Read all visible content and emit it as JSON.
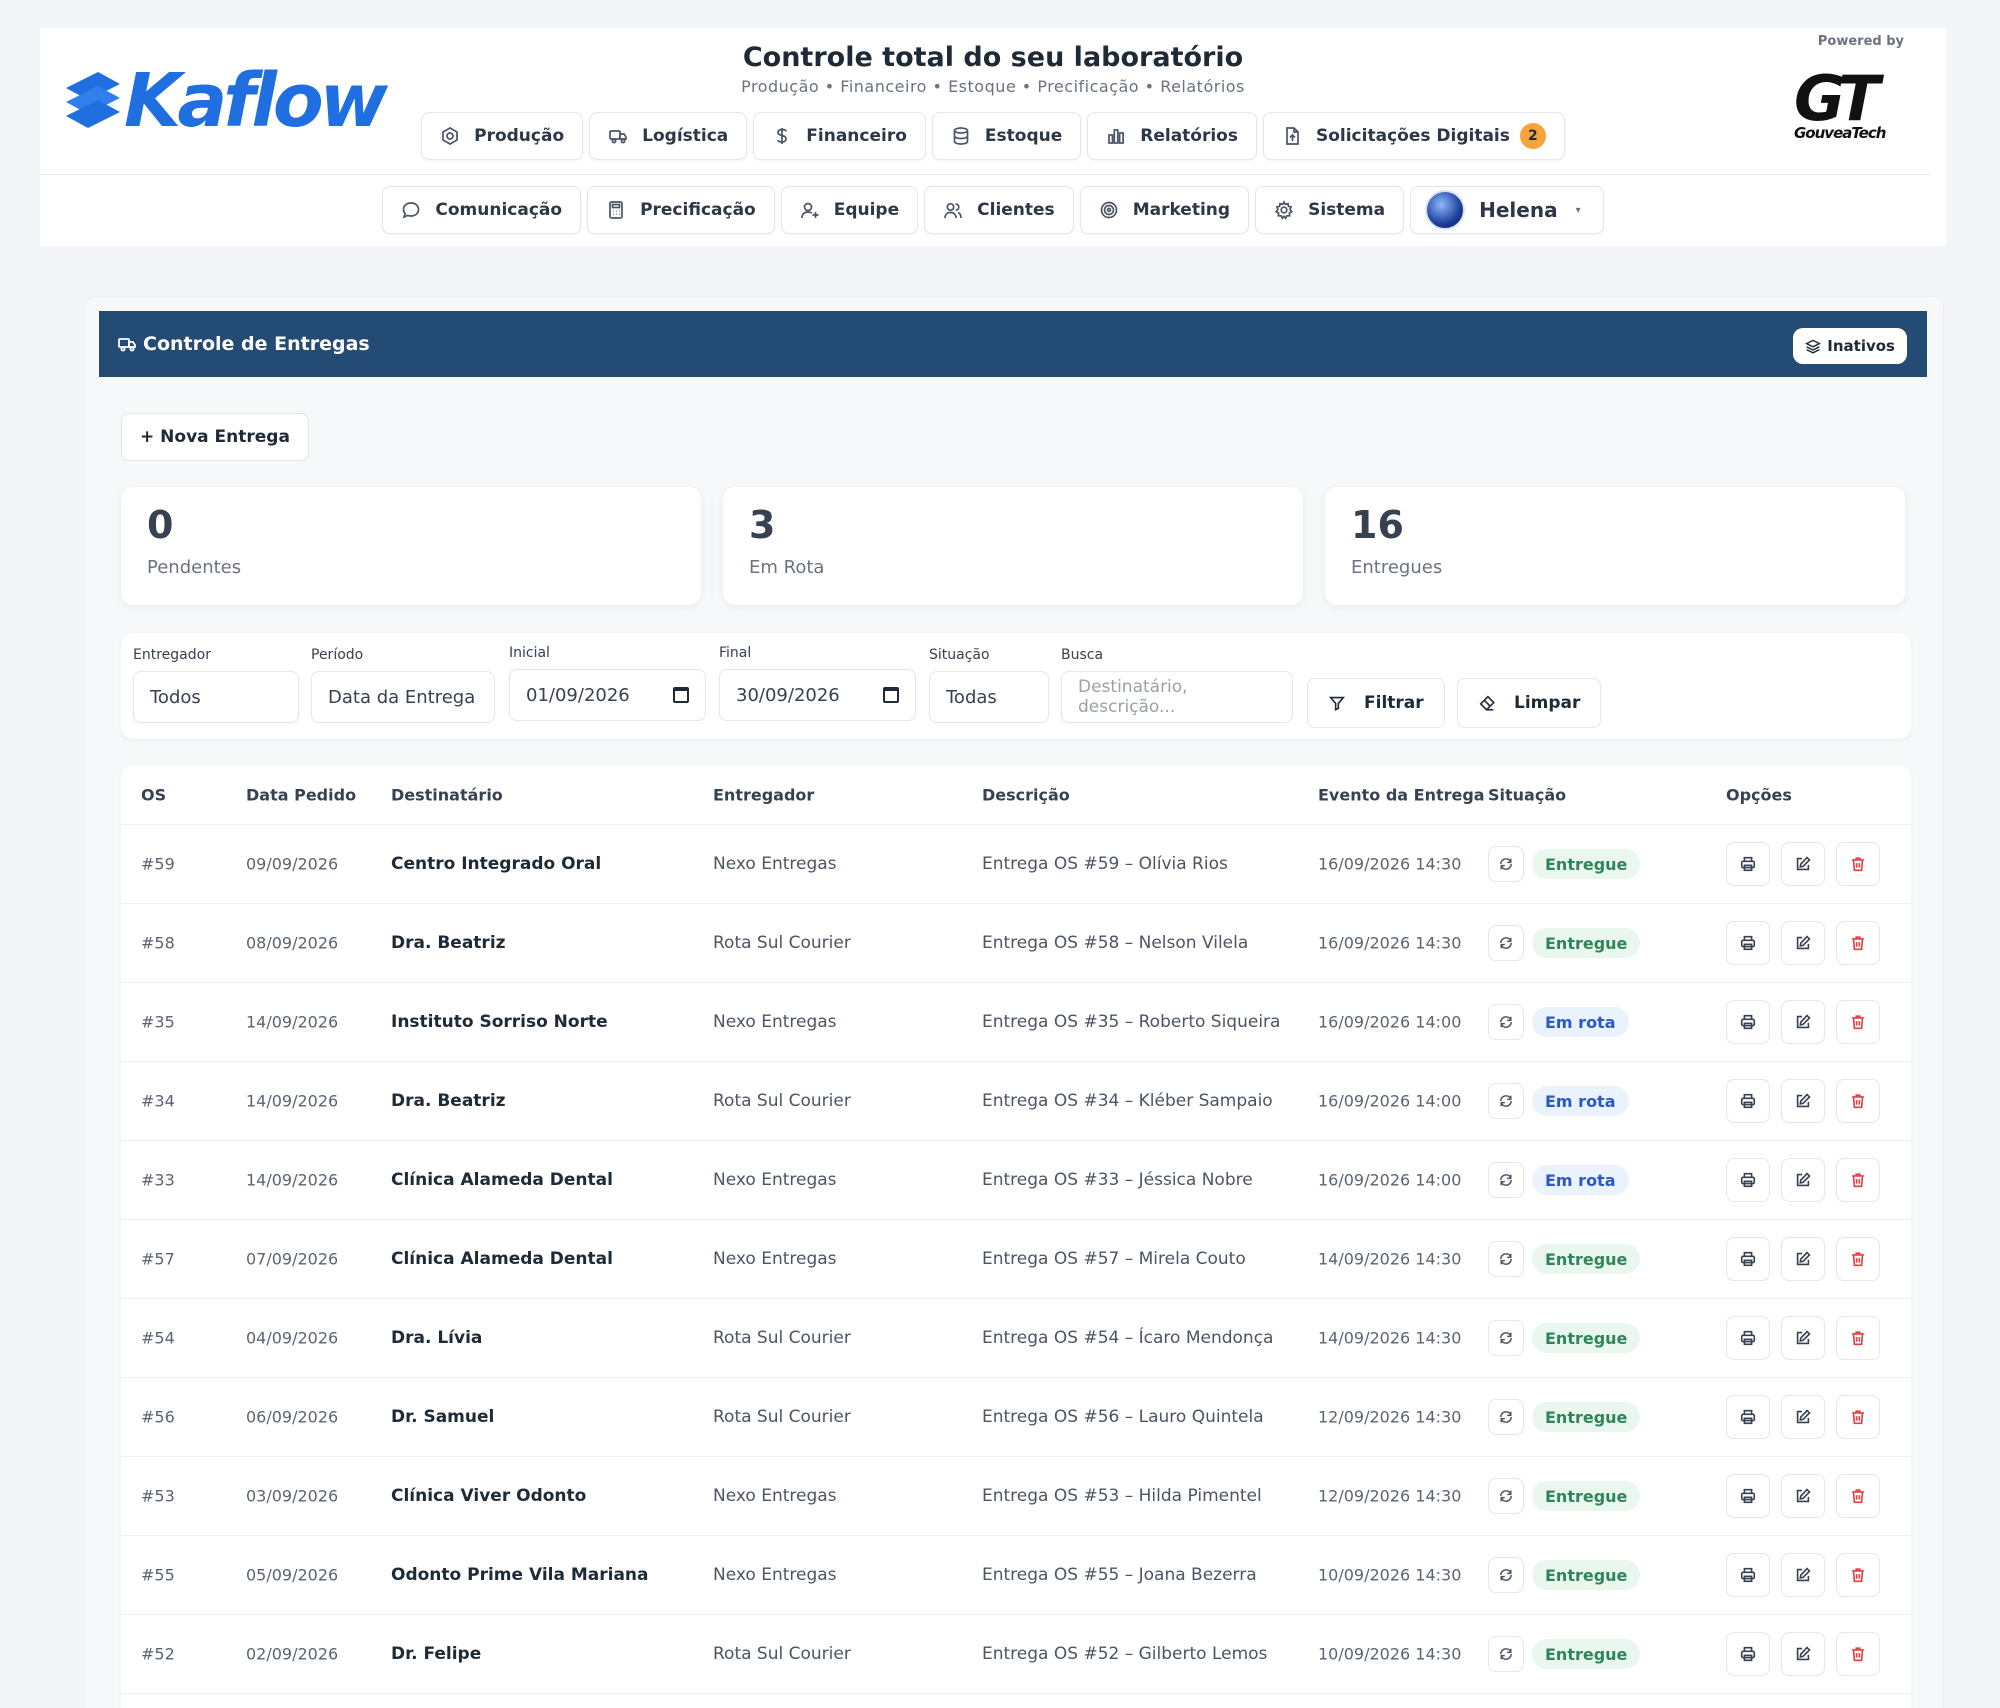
{
  "brand": {
    "name": "Kaflow",
    "powered_by": "Powered by",
    "partner": "GT",
    "partner_sub": "GouveaTech"
  },
  "header": {
    "title": "Controle total do seu laboratório",
    "subtitle": "Produção • Financeiro • Estoque • Precificação • Relatórios"
  },
  "nav_row1": [
    {
      "label": "Produção",
      "icon": "production-icon"
    },
    {
      "label": "Logística",
      "icon": "truck-icon"
    },
    {
      "label": "Financeiro",
      "icon": "dollar-icon"
    },
    {
      "label": "Estoque",
      "icon": "database-icon"
    },
    {
      "label": "Relatórios",
      "icon": "bar-chart-icon"
    },
    {
      "label": "Solicitações Digitais",
      "icon": "file-upload-icon",
      "badge": "2"
    }
  ],
  "nav_row2": [
    {
      "label": "Comunicação",
      "icon": "chat-icon"
    },
    {
      "label": "Precificação",
      "icon": "calculator-icon"
    },
    {
      "label": "Equipe",
      "icon": "user-plus-icon"
    },
    {
      "label": "Clientes",
      "icon": "users-icon"
    },
    {
      "label": "Marketing",
      "icon": "target-icon"
    },
    {
      "label": "Sistema",
      "icon": "gear-icon"
    }
  ],
  "user": {
    "name": "Helena"
  },
  "section": {
    "title": "Controle de Entregas",
    "inativos_label": "Inativos"
  },
  "nova_entrega_label": "+ Nova Entrega",
  "stats": [
    {
      "value": "0",
      "label": "Pendentes"
    },
    {
      "value": "3",
      "label": "Em Rota"
    },
    {
      "value": "16",
      "label": "Entregues"
    }
  ],
  "filters": {
    "entregador": {
      "label": "Entregador",
      "value": "Todos"
    },
    "periodo": {
      "label": "Período",
      "value": "Data da Entrega"
    },
    "inicial": {
      "label": "Inicial",
      "value": "01/09/2026"
    },
    "final": {
      "label": "Final",
      "value": "30/09/2026"
    },
    "situacao": {
      "label": "Situação",
      "value": "Todas"
    },
    "busca": {
      "label": "Busca",
      "placeholder": "Destinatário, descrição..."
    },
    "filtrar_label": "Filtrar",
    "limpar_label": "Limpar"
  },
  "table": {
    "headers": [
      "OS",
      "Data Pedido",
      "Destinatário",
      "Entregador",
      "Descrição",
      "Evento da Entrega",
      "Situação",
      "Opções"
    ],
    "rows": [
      {
        "os": "#59",
        "data": "09/09/2026",
        "dest": "Centro Integrado Oral",
        "ent": "Nexo Entregas",
        "desc": "Entrega OS #59 – Olívia Rios",
        "evt": "16/09/2026 14:30",
        "sit": "Entregue",
        "status": "ok"
      },
      {
        "os": "#58",
        "data": "08/09/2026",
        "dest": "Dra. Beatriz",
        "ent": "Rota Sul Courier",
        "desc": "Entrega OS #58 – Nelson Vilela",
        "evt": "16/09/2026 14:30",
        "sit": "Entregue",
        "status": "ok"
      },
      {
        "os": "#35",
        "data": "14/09/2026",
        "dest": "Instituto Sorriso Norte",
        "ent": "Nexo Entregas",
        "desc": "Entrega OS #35 – Roberto Siqueira",
        "evt": "16/09/2026 14:00",
        "sit": "Em rota",
        "status": "rota"
      },
      {
        "os": "#34",
        "data": "14/09/2026",
        "dest": "Dra. Beatriz",
        "ent": "Rota Sul Courier",
        "desc": "Entrega OS #34 – Kléber Sampaio",
        "evt": "16/09/2026 14:00",
        "sit": "Em rota",
        "status": "rota"
      },
      {
        "os": "#33",
        "data": "14/09/2026",
        "dest": "Clínica Alameda Dental",
        "ent": "Nexo Entregas",
        "desc": "Entrega OS #33 – Jéssica Nobre",
        "evt": "16/09/2026 14:00",
        "sit": "Em rota",
        "status": "rota"
      },
      {
        "os": "#57",
        "data": "07/09/2026",
        "dest": "Clínica Alameda Dental",
        "ent": "Nexo Entregas",
        "desc": "Entrega OS #57 – Mirela Couto",
        "evt": "14/09/2026 14:30",
        "sit": "Entregue",
        "status": "ok"
      },
      {
        "os": "#54",
        "data": "04/09/2026",
        "dest": "Dra. Lívia",
        "ent": "Rota Sul Courier",
        "desc": "Entrega OS #54 – Ícaro Mendonça",
        "evt": "14/09/2026 14:30",
        "sit": "Entregue",
        "status": "ok"
      },
      {
        "os": "#56",
        "data": "06/09/2026",
        "dest": "Dr. Samuel",
        "ent": "Rota Sul Courier",
        "desc": "Entrega OS #56 – Lauro Quintela",
        "evt": "12/09/2026 14:30",
        "sit": "Entregue",
        "status": "ok"
      },
      {
        "os": "#53",
        "data": "03/09/2026",
        "dest": "Clínica Viver Odonto",
        "ent": "Nexo Entregas",
        "desc": "Entrega OS #53 – Hilda Pimentel",
        "evt": "12/09/2026 14:30",
        "sit": "Entregue",
        "status": "ok"
      },
      {
        "os": "#55",
        "data": "05/09/2026",
        "dest": "Odonto Prime Vila Mariana",
        "ent": "Nexo Entregas",
        "desc": "Entrega OS #55 – Joana Bezerra",
        "evt": "10/09/2026 14:30",
        "sit": "Entregue",
        "status": "ok"
      },
      {
        "os": "#52",
        "data": "02/09/2026",
        "dest": "Dr. Felipe",
        "ent": "Rota Sul Courier",
        "desc": "Entrega OS #52 – Gilberto Lemos",
        "evt": "10/09/2026 14:30",
        "sit": "Entregue",
        "status": "ok"
      }
    ]
  },
  "colors": {
    "brand_blue": "#1f6fe0",
    "section_bar": "#244b74",
    "badge": "#f6a33a",
    "delivered": "#2f855a",
    "en_route": "#2b59c3",
    "delete": "#e53e3e"
  }
}
